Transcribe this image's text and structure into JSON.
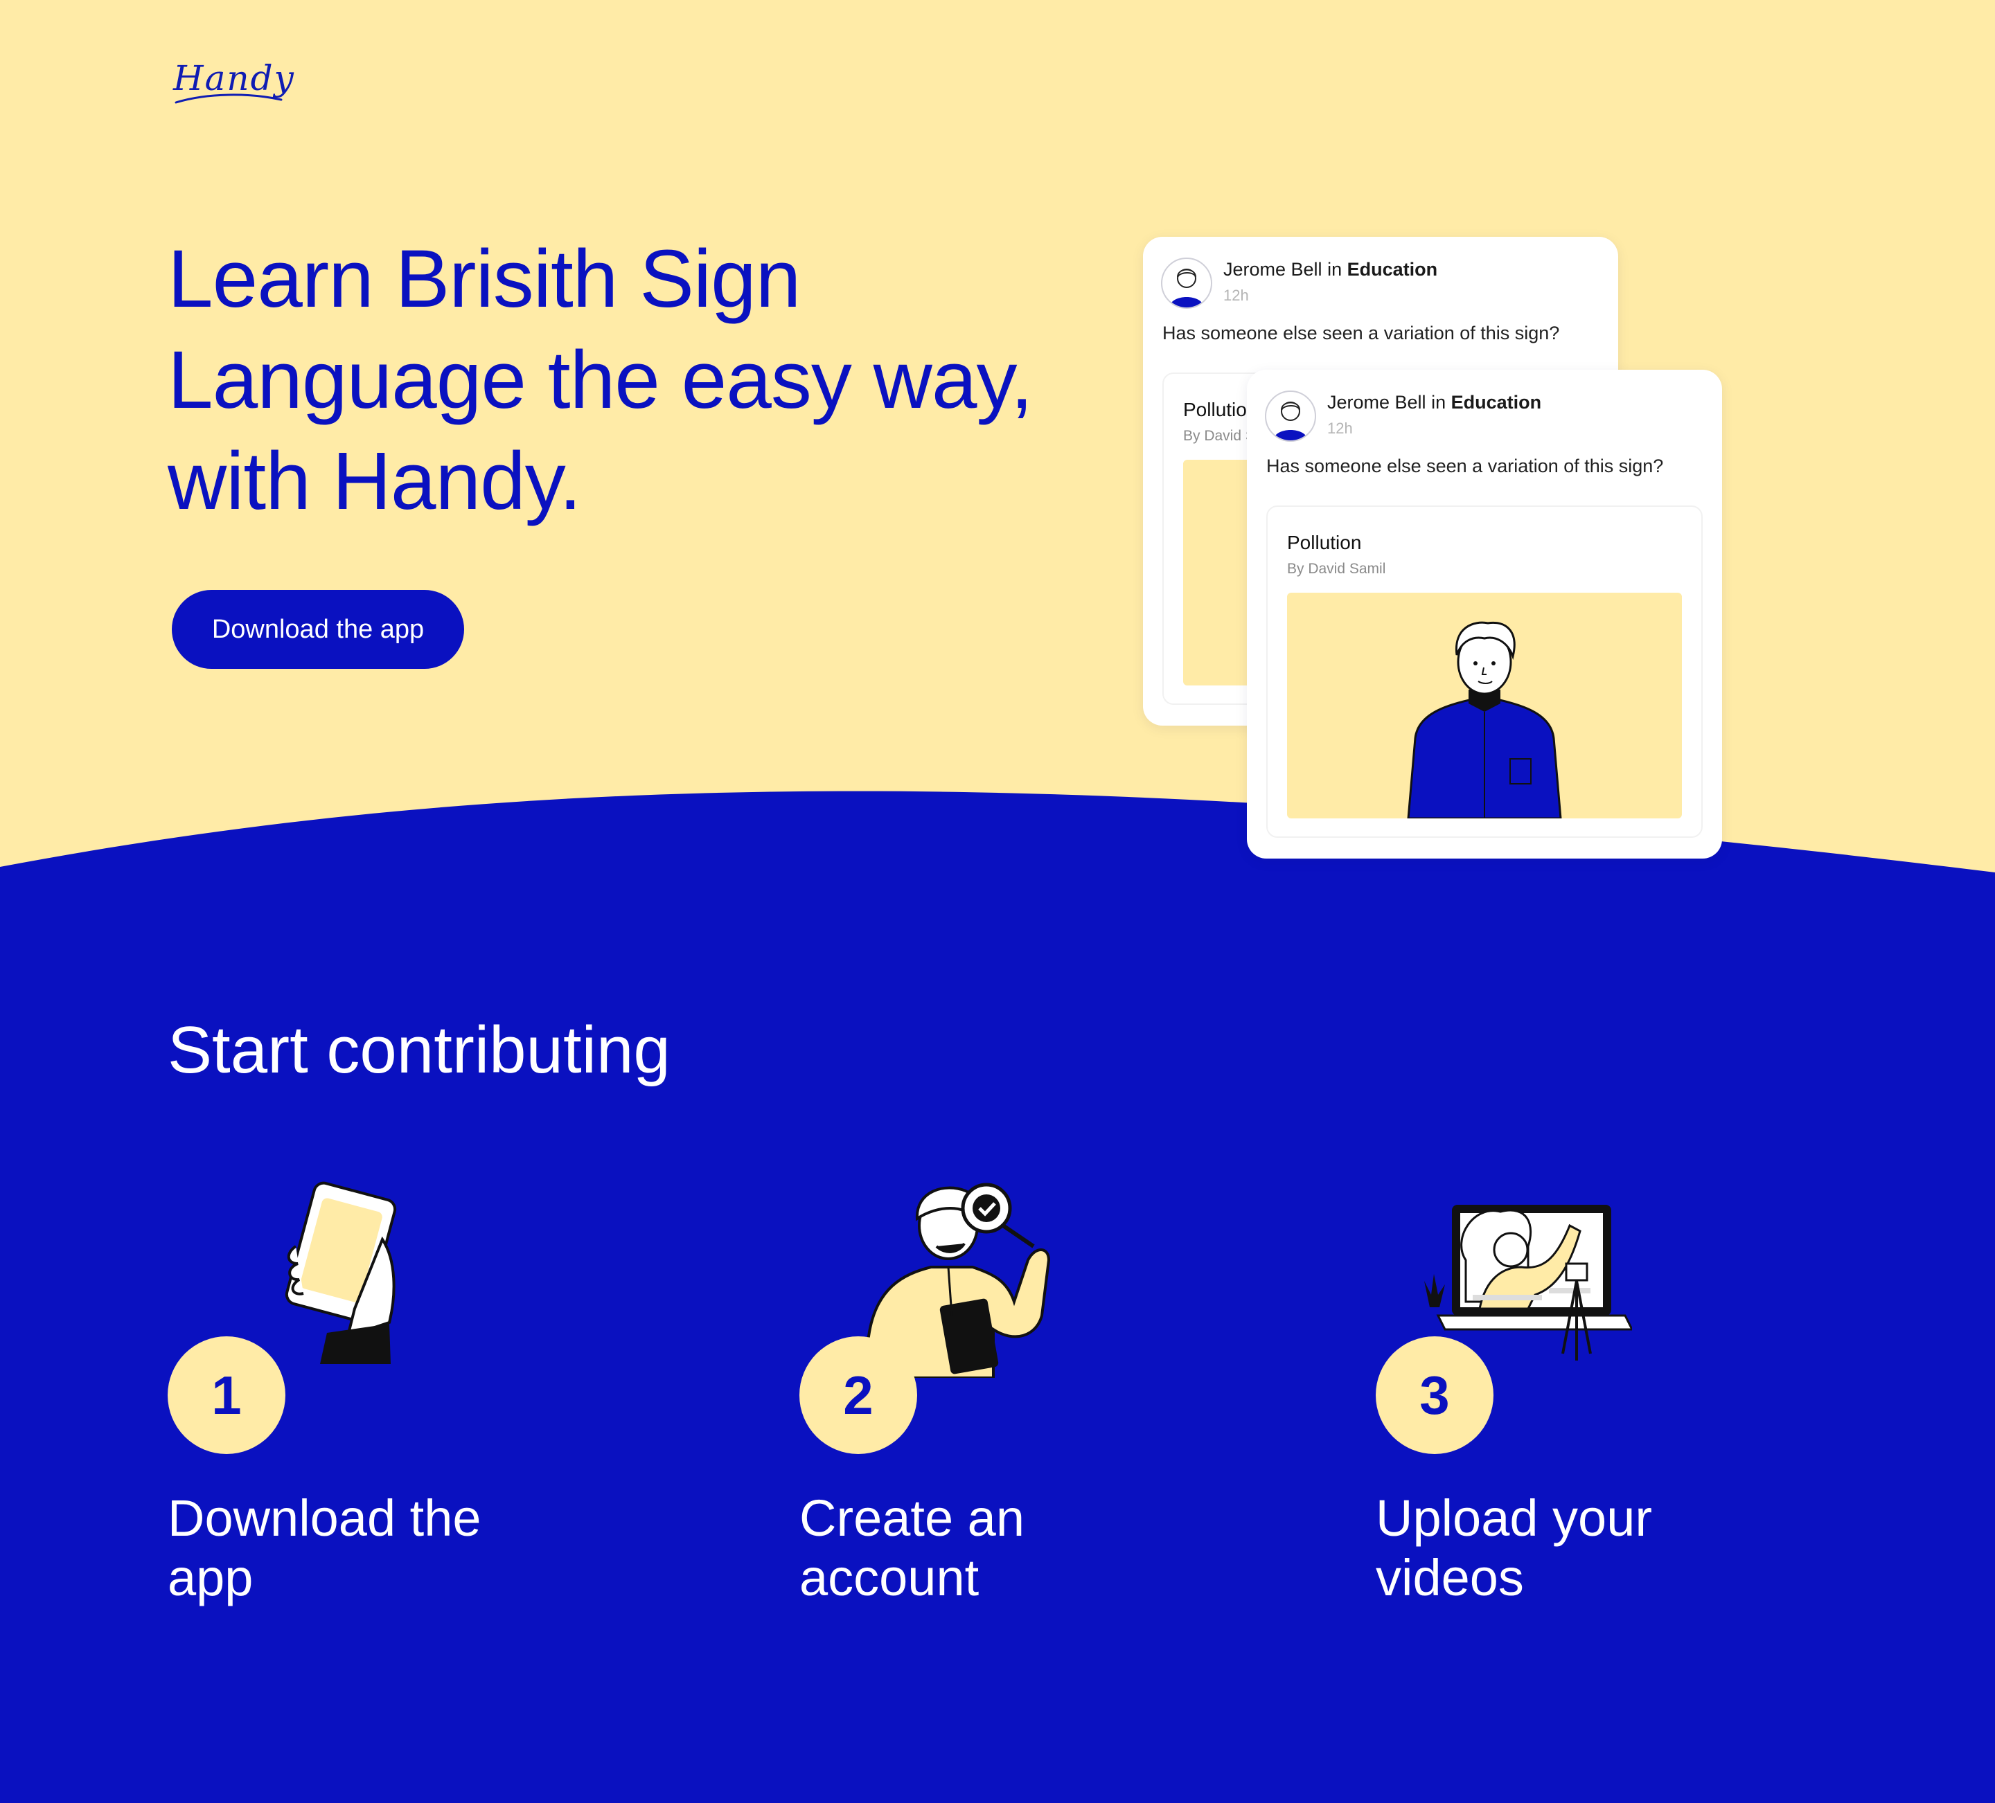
{
  "brand": {
    "logo_text": "Handy"
  },
  "hero": {
    "headline": "Learn Brisith Sign Language the easy way, with Handy.",
    "cta_label": "Download the app"
  },
  "cards": [
    {
      "author": "Jerome Bell",
      "in_word": "in",
      "community": "Education",
      "time": "12h",
      "question": "Has someone else seen a variation of this sign?",
      "post_title": "Pollution",
      "post_by": "By David Samil"
    },
    {
      "author": "Jerome Bell",
      "in_word": "in",
      "community": "Education",
      "time": "12h",
      "question": "Has someone else seen a variation of this sign?",
      "post_title": "Pollution",
      "post_by": "By David Samil"
    }
  ],
  "contribute": {
    "title": "Start contributing",
    "steps": [
      {
        "number": "1",
        "label": "Download the app",
        "icon": "phone-in-hand-icon"
      },
      {
        "number": "2",
        "label": "Create an account",
        "icon": "person-with-checkmark-icon"
      },
      {
        "number": "3",
        "label": "Upload your videos",
        "icon": "laptop-with-camera-icon"
      }
    ]
  },
  "colors": {
    "brand_blue": "#0a11c0",
    "cream": "#ffeba7",
    "white": "#ffffff"
  }
}
